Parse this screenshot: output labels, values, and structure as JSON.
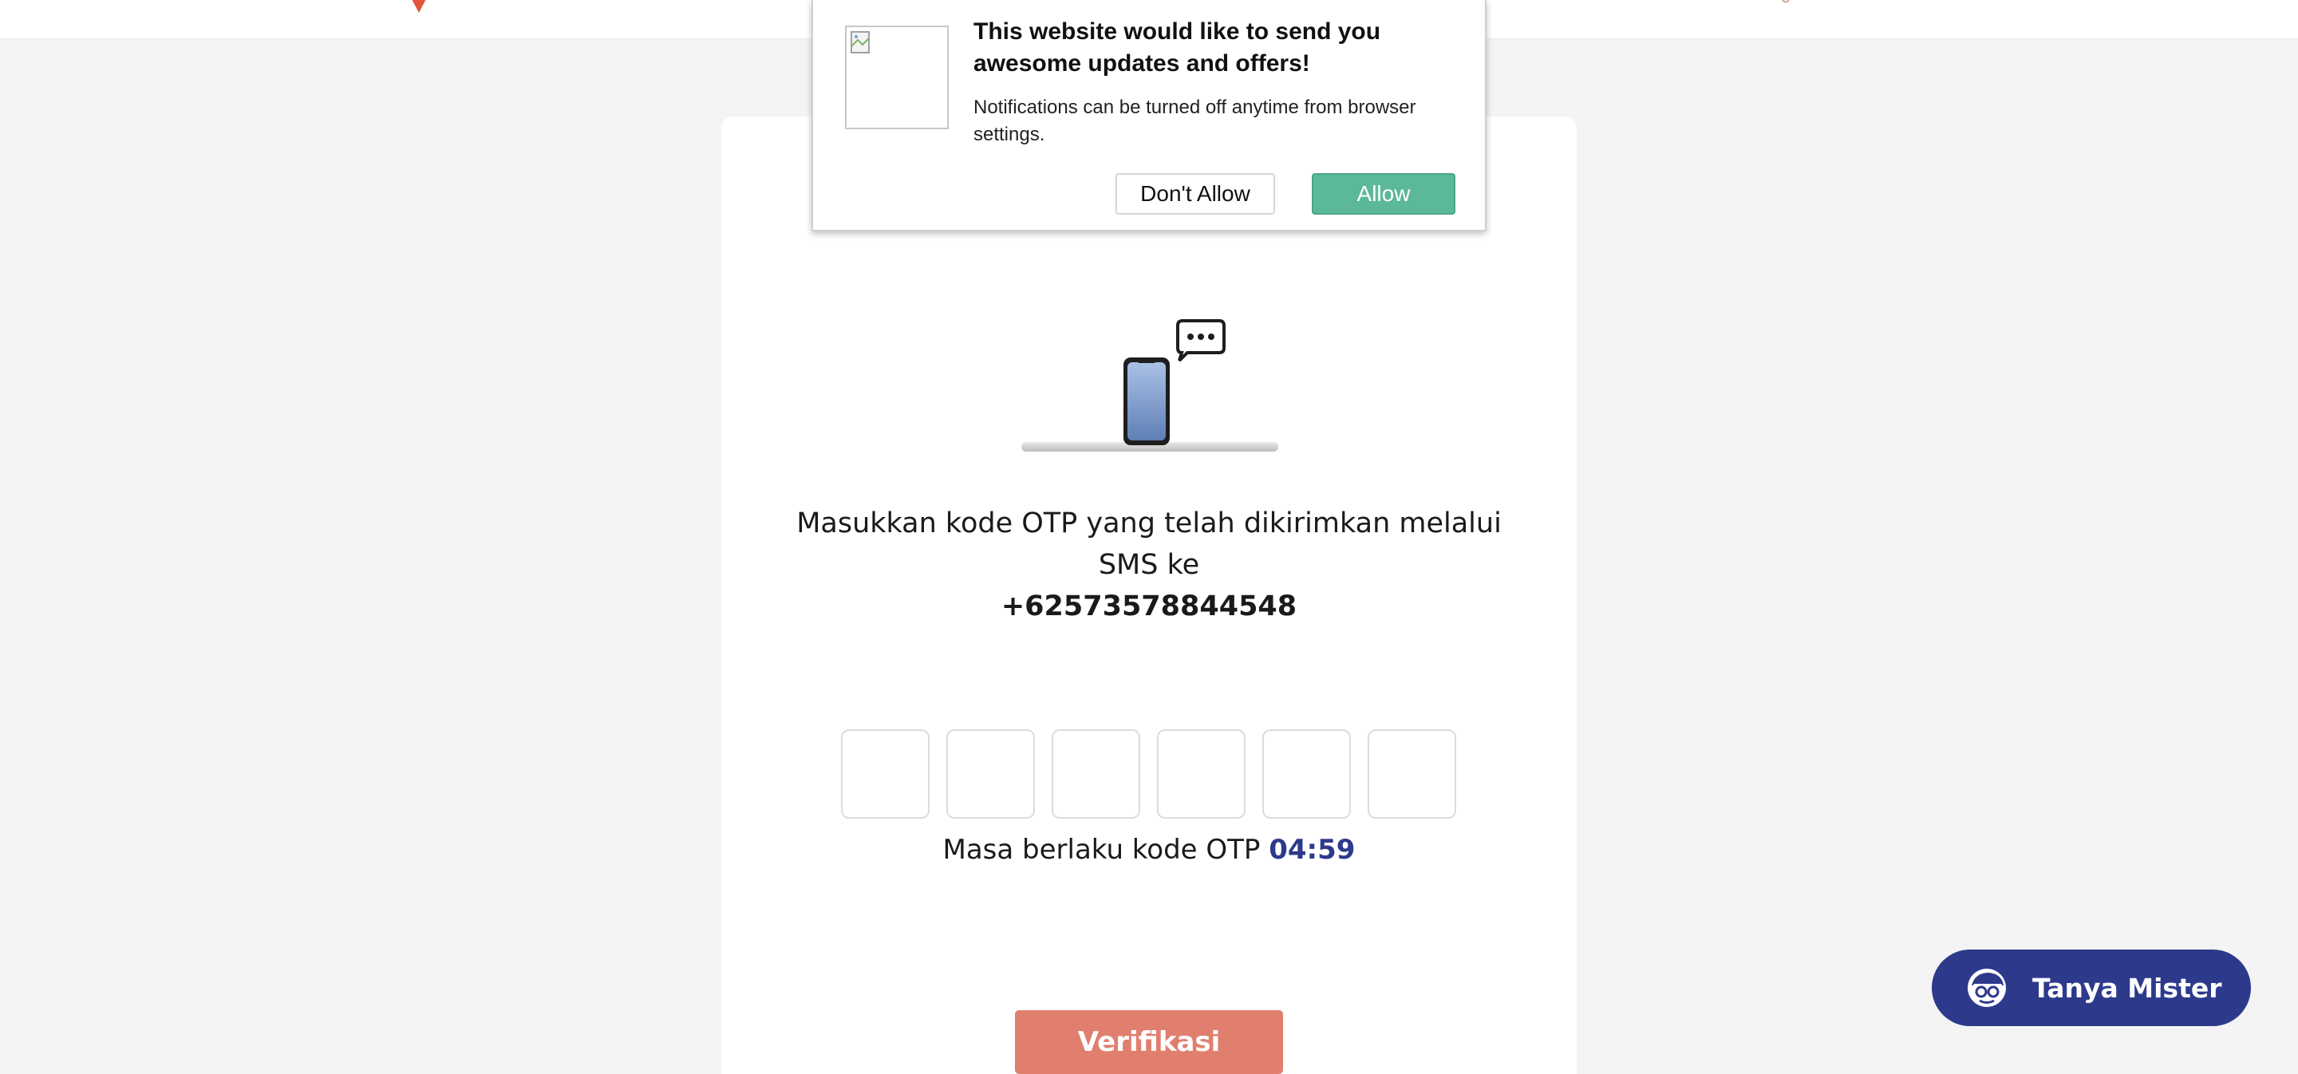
{
  "notification": {
    "title": "This website would like to send you awesome updates and offers!",
    "body": "Notifications can be turned off anytime from browser settings.",
    "deny_label": "Don't Allow",
    "allow_label": "Allow",
    "icon": "broken-image-icon"
  },
  "otp": {
    "message": "Masukkan kode OTP yang telah dikirimkan melalui SMS ke",
    "phone": "+62573578844548",
    "boxes": [
      "",
      "",
      "",
      "",
      "",
      ""
    ],
    "timer_label": "Masa berlaku kode OTP",
    "timer_value": "04:59",
    "verify_label": "Verifikasi"
  },
  "chat": {
    "label": "Tanya Mister",
    "icon": "mascot-icon"
  },
  "colors": {
    "accent": "#2d3a8c",
    "verify": "#e07f6e",
    "allow": "#5bb89a",
    "logo": "#e2553b"
  }
}
